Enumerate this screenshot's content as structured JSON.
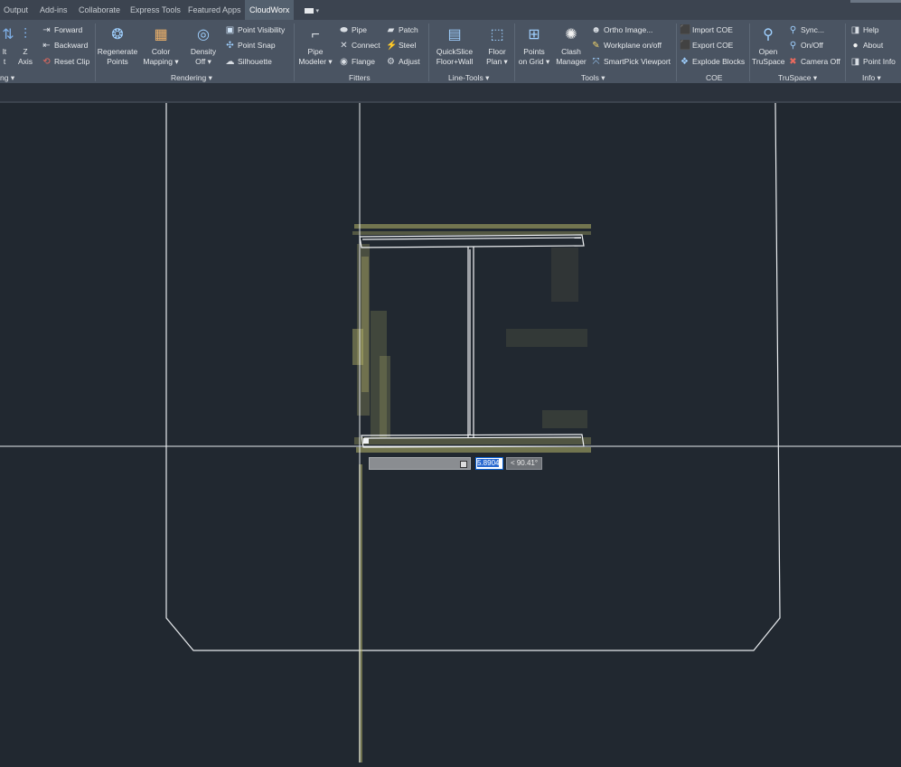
{
  "ribbon_tabs": {
    "output": "Output",
    "addins": "Add-ins",
    "collaborate": "Collaborate",
    "express": "Express Tools",
    "featured": "Featured Apps",
    "cloudworx": "CloudWorx"
  },
  "clipping": {
    "big1_line1": "lt",
    "big1_line2": "t",
    "big2_line1": "Z",
    "big2_line2": "Axis",
    "forward": "Forward",
    "backward": "Backward",
    "reset_clip": "Reset Clip",
    "group_label": "ng"
  },
  "rendering": {
    "regenerate_l1": "Regenerate",
    "regenerate_l2": "Points",
    "color_l1": "Color",
    "color_l2": "Mapping",
    "density_l1": "Density",
    "density_l2": "Off",
    "point_visibility": "Point Visibility",
    "point_snap": "Point Snap",
    "silhouette": "Silhouette",
    "group_label": "Rendering"
  },
  "fitters": {
    "pipe_modeler_l1": "Pipe",
    "pipe_modeler_l2": "Modeler",
    "pipe": "Pipe",
    "connect": "Connect",
    "flange": "Flange",
    "patch": "Patch",
    "steel": "Steel",
    "adjust": "Adjust",
    "group_label": "Fitters"
  },
  "linetools": {
    "quickslice_l1": "QuickSlice",
    "quickslice_l2": "Floor+Wall",
    "floorplan_l1": "Floor",
    "floorplan_l2": "Plan",
    "group_label": "Line-Tools"
  },
  "tools": {
    "points_grid_l1": "Points",
    "points_grid_l2": "on Grid",
    "clash_l1": "Clash",
    "clash_l2": "Manager",
    "ortho": "Ortho Image...",
    "workplane": "Workplane on/off",
    "smartpick": "SmartPick Viewport",
    "group_label": "Tools"
  },
  "coe": {
    "import": "Import COE",
    "export": "Export COE",
    "explode": "Explode Blocks",
    "group_label": "COE"
  },
  "truspace": {
    "open_l1": "Open",
    "open_l2": "TruSpace",
    "sync": "Sync...",
    "onoff": "On/Off",
    "camera_off": "Camera Off",
    "group_label": "TruSpace"
  },
  "info": {
    "help": "Help",
    "about": "About",
    "point_info": "Point Info",
    "group_label": "Info"
  },
  "dynamic_input": {
    "value": "5.8904",
    "angle": "< 90.41°"
  },
  "colors": {
    "canvas_bg": "#212830",
    "ribbon_bg": "#4a5462",
    "highlight": "#2a6ad1",
    "point_cloud": "#b7b56a"
  }
}
